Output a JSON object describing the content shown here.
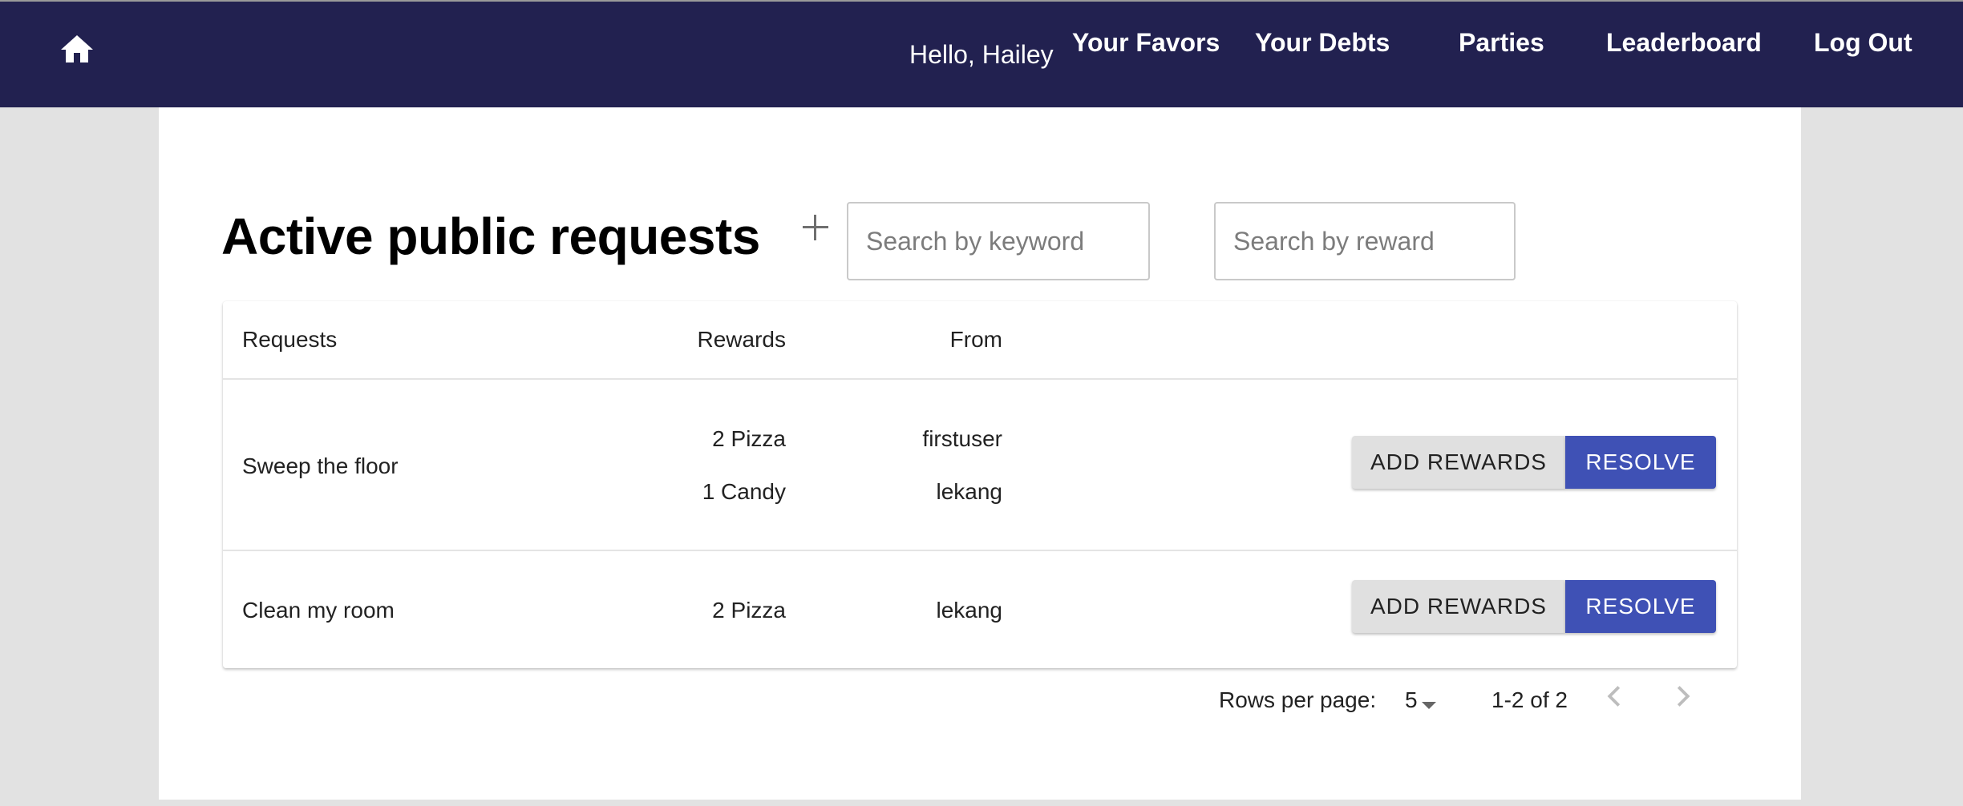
{
  "header": {
    "greeting": "Hello, Hailey",
    "nav": {
      "favors": "Your Favors",
      "debts": "Your Debts",
      "parties": "Parties",
      "leaderboard": "Leaderboard",
      "logout": "Log Out"
    },
    "icons": {
      "home": "home-icon"
    },
    "colors": {
      "background": "#222150",
      "text": "#ffffff"
    }
  },
  "main": {
    "title": "Active public requests",
    "search": {
      "keyword_placeholder": "Search by keyword",
      "reward_placeholder": "Search by reward"
    },
    "table": {
      "columns": [
        "Requests",
        "Rewards",
        "From"
      ],
      "rows": [
        {
          "request": "Sweep the floor",
          "rewards": [
            "2 Pizza",
            "1 Candy"
          ],
          "from": [
            "firstuser",
            "lekang"
          ],
          "actions": [
            "ADD REWARDS",
            "RESOLVE"
          ]
        },
        {
          "request": "Clean my room",
          "rewards": [
            "2 Pizza"
          ],
          "from": [
            "lekang"
          ],
          "actions": [
            "ADD REWARDS",
            "RESOLVE"
          ]
        }
      ]
    },
    "pagination": {
      "rows_per_page_label": "Rows per page:",
      "rows_per_page_value": "5",
      "range": "1-2 of 2"
    },
    "colors": {
      "primary": "#3f51b5",
      "secondary_button": "#e0e0e0"
    }
  }
}
